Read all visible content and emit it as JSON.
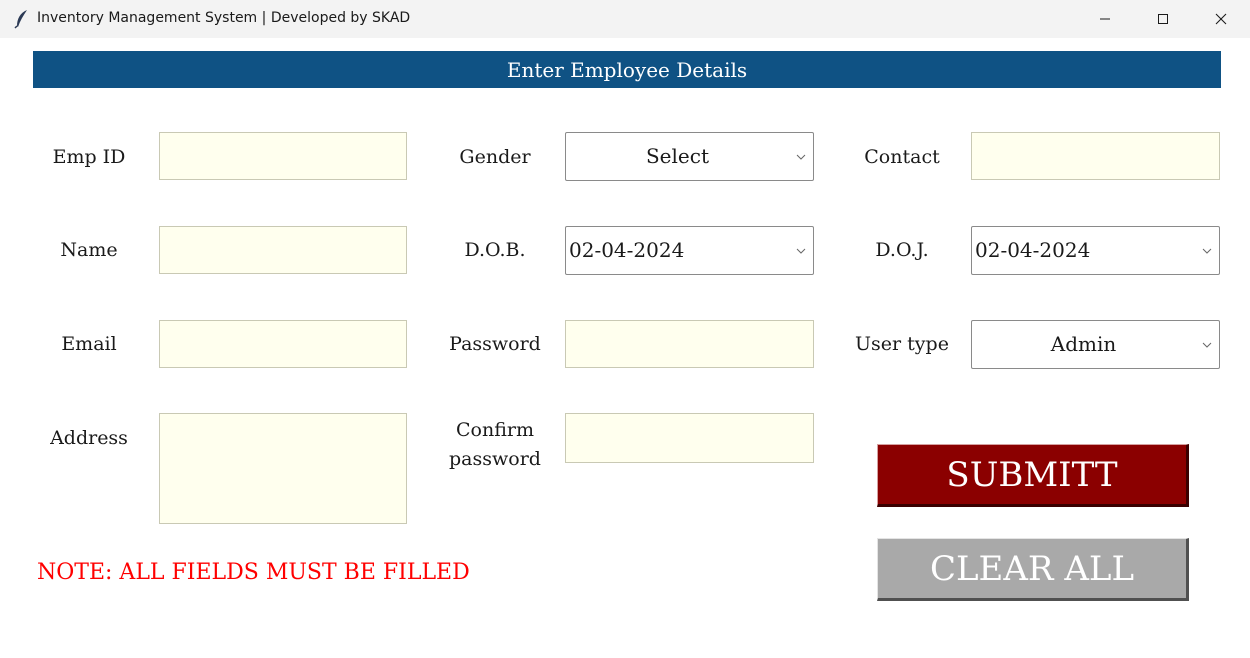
{
  "window": {
    "title": "Inventory Management System | Developed by SKAD",
    "icon": "feather-icon"
  },
  "header": {
    "title": "Enter Employee Details"
  },
  "form": {
    "emp_id": {
      "label": "Emp ID",
      "value": ""
    },
    "name": {
      "label": "Name",
      "value": ""
    },
    "email": {
      "label": "Email",
      "value": ""
    },
    "address": {
      "label": "Address",
      "value": ""
    },
    "gender": {
      "label": "Gender",
      "value": "Select"
    },
    "dob": {
      "label": "D.O.B.",
      "value": "02-04-2024"
    },
    "password": {
      "label": "Password",
      "value": ""
    },
    "confirm_password": {
      "label_line1": "Confirm",
      "label_line2": "password",
      "value": ""
    },
    "contact": {
      "label": "Contact",
      "value": ""
    },
    "doj": {
      "label": "D.O.J.",
      "value": "02-04-2024"
    },
    "user_type": {
      "label": "User type",
      "value": "Admin"
    }
  },
  "note": "NOTE: ALL FIELDS MUST BE FILLED",
  "buttons": {
    "submit": "SUBMITT",
    "clear": "CLEAR ALL"
  },
  "colors": {
    "header_bg": "#0f5284",
    "entry_bg": "#ffffee",
    "submit_bg": "#8b0000",
    "clear_bg": "#a9a9a9",
    "note_color": "#ff0000"
  }
}
